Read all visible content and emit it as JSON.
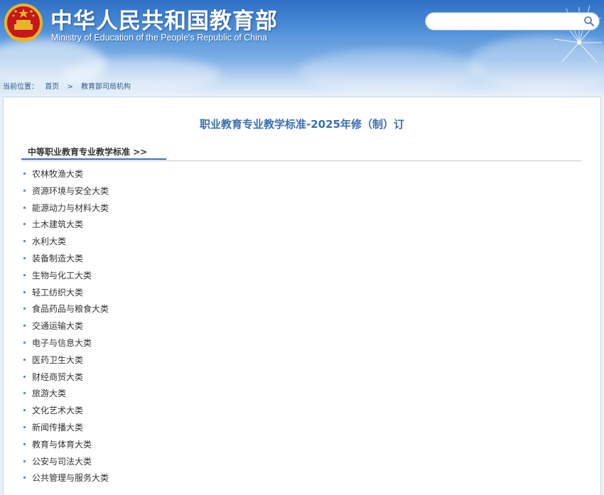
{
  "header": {
    "title": "中华人民共和国教育部",
    "subtitle": "Ministry of Education of the People's Republic of China",
    "search": {
      "value": "",
      "placeholder": ""
    }
  },
  "breadcrumb": {
    "label": "当前位置：",
    "home": "首页",
    "separator": ">",
    "current": "教育部司局机构"
  },
  "main": {
    "title": "职业教育专业教学标准-2025年修（制）订",
    "section_tab": "中等职业教育专业教学标准 >>",
    "categories": [
      "农林牧渔大类",
      "资源环境与安全大类",
      "能源动力与材料大类",
      "土木建筑大类",
      "水利大类",
      "装备制造大类",
      "生物与化工大类",
      "轻工纺织大类",
      "食品药品与粮食大类",
      "交通运输大类",
      "电子与信息大类",
      "医药卫生大类",
      "财经商贸大类",
      "旅游大类",
      "文化艺术大类",
      "新闻传播大类",
      "教育与体育大类",
      "公安与司法大类",
      "公共管理与服务大类"
    ]
  },
  "colors": {
    "accent": "#3a6fb0",
    "header_top": "#2f6fc4",
    "text": "#333333"
  },
  "icons": [
    "national-emblem-icon",
    "search-icon",
    "bullet-icon"
  ]
}
